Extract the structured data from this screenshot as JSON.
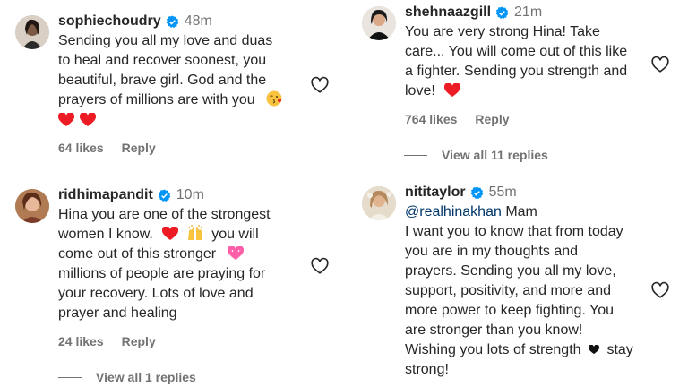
{
  "comments": [
    {
      "username": "sophiechoudry",
      "time": "48m",
      "lines": [
        "Sending you all my love and duas",
        "to heal and recover soonest, you",
        "beautiful, brave girl. God and the",
        "prayers of millions are with you"
      ],
      "likes": "64 likes",
      "reply": "Reply"
    },
    {
      "username": "ridhimapandit",
      "time": "10m",
      "lines": [
        "Hina you are one of the strongest",
        "women I know.",
        "you will",
        "come out of this stronger",
        "millions of people are praying for",
        "your recovery. Lots of love and",
        "prayer and healing"
      ],
      "likes": "24 likes",
      "reply": "Reply",
      "view_replies": "View all 1 replies"
    },
    {
      "username": "shehnaazgill",
      "time": "21m",
      "lines": [
        "You are very strong Hina! Take",
        "care... You will come out of this like",
        "a fighter. Sending you strength and",
        "love!"
      ],
      "likes": "764 likes",
      "reply": "Reply",
      "view_replies": "View all 11 replies"
    },
    {
      "username": "nititaylor",
      "time": "55m",
      "mention": "@realhinakhan",
      "lines": [
        "Mam",
        "I want you to know that from today",
        "you are in my thoughts and",
        "prayers. Sending you all my love,",
        "support, positivity, and more and",
        "more power to keep fighting. You",
        "are stronger than you know!",
        "Wishing you lots of strength",
        "stay",
        "strong!"
      ],
      "likes": "",
      "reply": ""
    }
  ],
  "colors": {
    "verified": "#0095f6",
    "heart": "#ed1c24",
    "muted": "#737373",
    "mention": "#00376b"
  },
  "icons": {
    "like": "heart-outline-icon",
    "verified": "verified-badge-icon"
  }
}
